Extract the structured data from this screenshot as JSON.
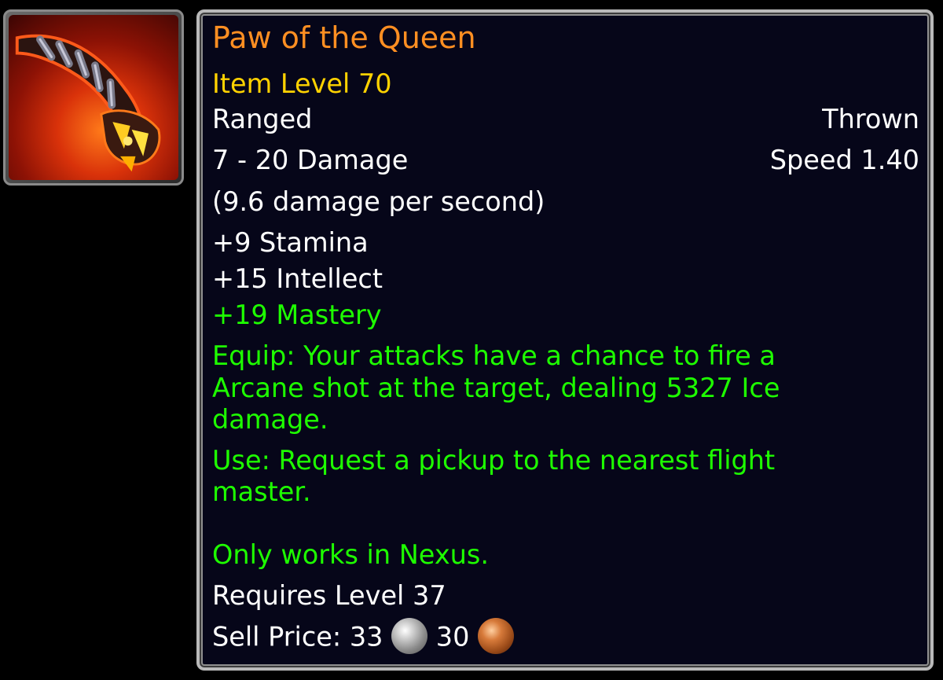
{
  "item": {
    "icon": "thrown-claw-weapon-icon",
    "name": "Paw of the Queen",
    "item_level": "Item Level 70",
    "slot": "Ranged",
    "type": "Thrown",
    "damage": "7 - 20 Damage",
    "speed": "Speed 1.40",
    "dps": "(9.6 damage per second)",
    "stats": [
      "+9 Stamina",
      "+15 Intellect"
    ],
    "green_stats": [
      "+19 Mastery"
    ],
    "equip_effect": [
      "Equip: Your attacks have a chance to fire a",
      "Arcane shot at the target, dealing 5327 Ice",
      "damage."
    ],
    "use_effect": [
      "Use: Request a pickup to the nearest flight",
      "master."
    ],
    "note": "Only works in Nexus.",
    "requirement": "Requires Level 37",
    "sell_price": {
      "label": "Sell Price:",
      "silver": "33",
      "copper": "30"
    }
  },
  "colors": {
    "name": "#ff8f22",
    "item_level": "#ffd200",
    "green_text": "#1eff00",
    "background": "#060619"
  }
}
